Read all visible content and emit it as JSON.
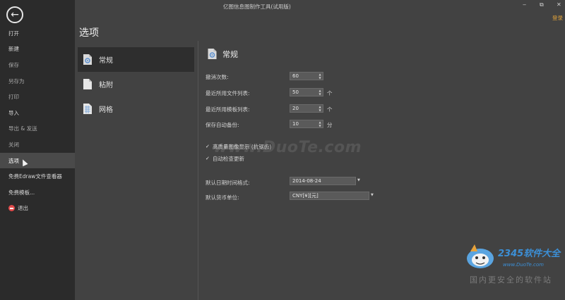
{
  "titlebar": {
    "app_title": "亿图信息图制作工具(试用版)",
    "login": "登录",
    "minimize": "‒",
    "restore": "⧉",
    "close": "✕"
  },
  "sidebar": {
    "back_icon": "arrow-left-icon",
    "items": [
      {
        "label": "打开"
      },
      {
        "label": "新建"
      },
      {
        "label": "保存"
      },
      {
        "label": "另存为"
      },
      {
        "label": "打印"
      },
      {
        "label": "导入"
      },
      {
        "label": "导出 & 发送"
      },
      {
        "label": "关闭"
      },
      {
        "label": "选项"
      },
      {
        "label": "免费Edraw文件查看器"
      },
      {
        "label": "免费模板..."
      },
      {
        "label": "退出"
      }
    ]
  },
  "page": {
    "title": "选项"
  },
  "categories": [
    {
      "label": "常规",
      "icon": "settings-doc-icon"
    },
    {
      "label": "粘附",
      "icon": "document-icon"
    },
    {
      "label": "网格",
      "icon": "grid-doc-icon"
    }
  ],
  "general": {
    "title": "常规",
    "undo": {
      "label": "撤消次数:",
      "value": "60"
    },
    "recent_files": {
      "label": "最近所用文件列表:",
      "value": "50",
      "unit": "个"
    },
    "recent_templates": {
      "label": "最近所用模板列表:",
      "value": "20",
      "unit": "个"
    },
    "autosave": {
      "label": "保存自动备份:",
      "value": "10",
      "unit": "分"
    },
    "hq_display": {
      "label": "高质量图像显示 (抗锯齿)",
      "checked": true
    },
    "auto_update": {
      "label": "自动检查更新",
      "checked": true
    },
    "date_format": {
      "label": "默认日期时间格式:",
      "value": "2014-08-24"
    },
    "currency": {
      "label": "默认货币单位:",
      "value": "CNY[¥][元]"
    }
  },
  "watermark": {
    "main": "www.DuoTe.com",
    "site": "2345软件大全",
    "url": "www.DuoTe.com",
    "slogan": "国内更安全的软件站"
  }
}
